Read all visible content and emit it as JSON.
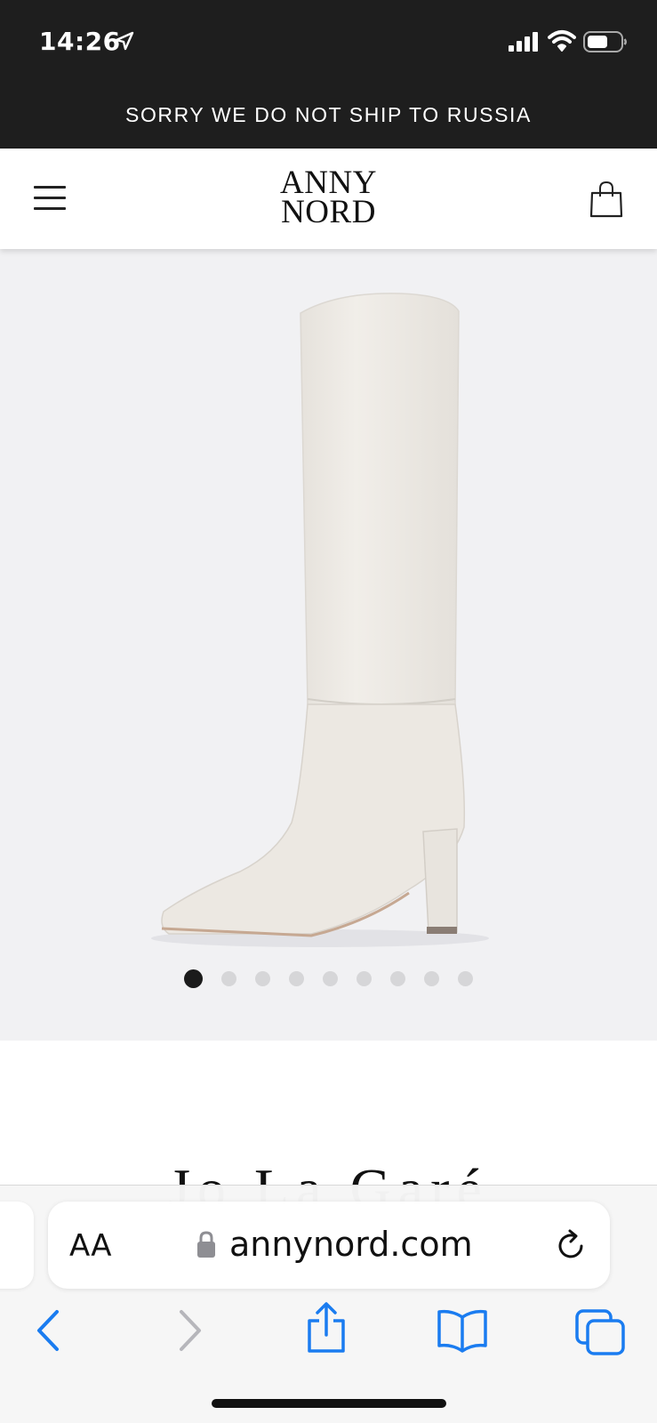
{
  "status_bar": {
    "time": "14:26"
  },
  "promo": {
    "text": "SORRY WE DO NOT SHIP TO RUSSIA"
  },
  "header": {
    "logo_line1": "ANNY",
    "logo_line2": "NORD"
  },
  "gallery": {
    "image_count": 9,
    "active_index": 0
  },
  "product": {
    "title_peek": "Jo La Garé"
  },
  "safari": {
    "text_size_label": "AA",
    "url": "annynord.com"
  },
  "colors": {
    "promo_bg": "#1e1e1e",
    "gallery_bg": "#f1f1f3",
    "ios_blue": "#1a7cf0",
    "boot_color": "#ede9e3"
  },
  "icons": [
    "location-arrow-icon",
    "cellular-signal-icon",
    "wifi-icon",
    "battery-icon",
    "hamburger-menu-icon",
    "shopping-bag-icon",
    "lock-icon",
    "reload-icon",
    "back-chevron-icon",
    "forward-chevron-icon",
    "share-icon",
    "bookmarks-icon",
    "tabs-icon"
  ]
}
